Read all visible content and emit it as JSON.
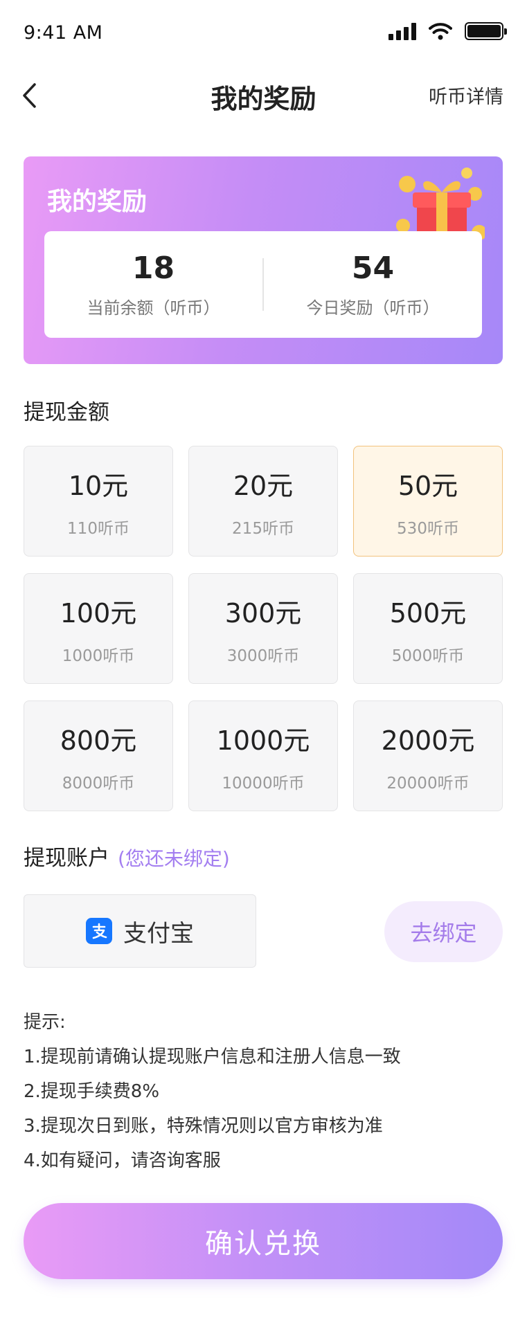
{
  "status_bar": {
    "time": "9:41 AM",
    "icons": [
      "signal-icon",
      "wifi-icon",
      "battery-icon"
    ]
  },
  "nav": {
    "title": "我的奖励",
    "right_link": "听币详情",
    "back_icon": "chevron-left-icon"
  },
  "reward_card": {
    "title": "我的奖励",
    "balance_value": "18",
    "balance_label": "当前余额（听币）",
    "today_value": "54",
    "today_label": "今日奖励（听币）"
  },
  "withdraw": {
    "title": "提现金额",
    "selected_index": 2,
    "options": [
      {
        "price": "10元",
        "coins": "110听币"
      },
      {
        "price": "20元",
        "coins": "215听币"
      },
      {
        "price": "50元",
        "coins": "530听币"
      },
      {
        "price": "100元",
        "coins": "1000听币"
      },
      {
        "price": "300元",
        "coins": "3000听币"
      },
      {
        "price": "500元",
        "coins": "5000听币"
      },
      {
        "price": "800元",
        "coins": "8000听币"
      },
      {
        "price": "1000元",
        "coins": "10000听币"
      },
      {
        "price": "2000元",
        "coins": "20000听币"
      }
    ]
  },
  "account": {
    "title": "提现账户",
    "hint": "(您还未绑定)",
    "method_label": "支付宝",
    "bind_label": "去绑定"
  },
  "tips": {
    "title": "提示:",
    "lines": [
      "1.提现前请确认提现账户信息和注册人信息一致",
      "2.提现手续费8%",
      "3.提现次日到账，特殊情况则以官方审核为准",
      "4.如有疑问，请咨询客服"
    ]
  },
  "confirm_label": "确认兑换",
  "colors": {
    "accent_purple": "#a47cea",
    "gradient_start": "#e99bf6",
    "gradient_end": "#a389f8",
    "selected_bg": "#fff6e7",
    "selected_border": "#f2c27d",
    "alipay_blue": "#1677ff"
  }
}
